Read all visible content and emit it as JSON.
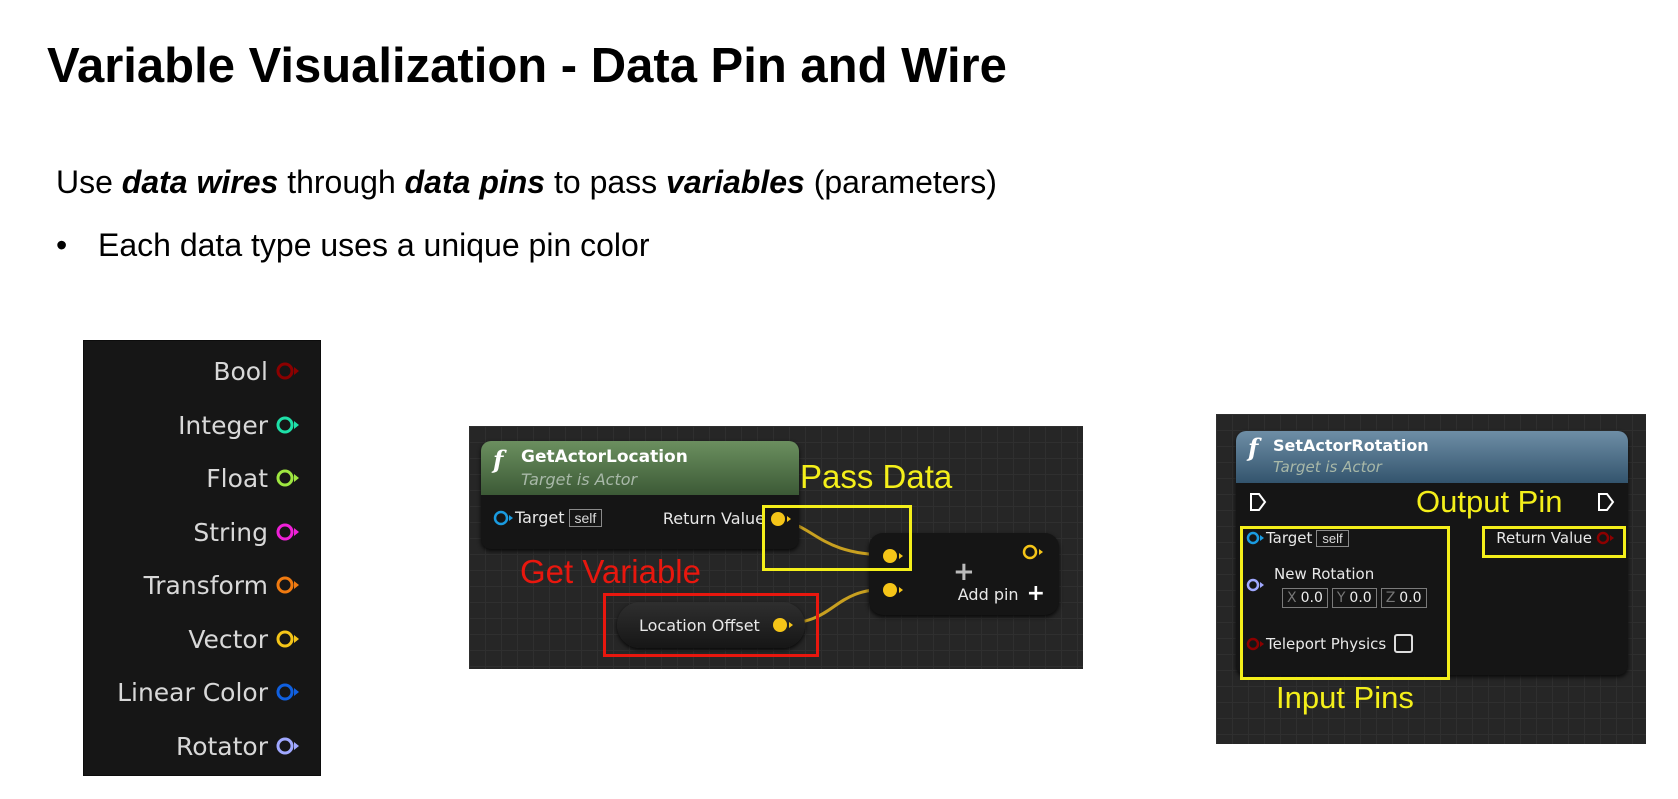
{
  "title": "Variable Visualization - Data Pin and Wire",
  "intro": {
    "t1": "Use ",
    "b1": "data wires",
    "t2": " through ",
    "b2": "data pins",
    "t3": " to pass ",
    "b3": "variables",
    "t4": " (parameters)"
  },
  "bullet": {
    "marker": "•",
    "text": "Each data type uses a unique pin color"
  },
  "pin_types": [
    {
      "label": "Bool",
      "color": "#8c0000"
    },
    {
      "label": "Integer",
      "color": "#1ee0a8"
    },
    {
      "label": "Float",
      "color": "#9ee640"
    },
    {
      "label": "String",
      "color": "#f020d8"
    },
    {
      "label": "Transform",
      "color": "#f07a10"
    },
    {
      "label": "Vector",
      "color": "#f5c518"
    },
    {
      "label": "Linear Color",
      "color": "#1060e0"
    },
    {
      "label": "Rotator",
      "color": "#a0a8ff"
    }
  ],
  "example1": {
    "node_title": "GetActorLocation",
    "node_subtitle": "Target is Actor",
    "target_label": "Target",
    "self_label": "self",
    "return_label": "Return Value",
    "variable_label": "Location Offset",
    "add_pin_label": "Add pin",
    "annotation_pass": "Pass Data",
    "annotation_get": "Get Variable",
    "function_glyph": "f",
    "plus_glyph": "+"
  },
  "example2": {
    "node_title": "SetActorRotation",
    "node_subtitle": "Target is Actor",
    "target_label": "Target",
    "self_label": "self",
    "rotation_label": "New Rotation",
    "x_label": "X",
    "x_value": "0.0",
    "y_label": "Y",
    "y_value": "0.0",
    "z_label": "Z",
    "z_value": "0.0",
    "teleport_label": "Teleport Physics",
    "return_label": "Return Value",
    "annotation_output": "Output Pin",
    "annotation_input": "Input Pins",
    "function_glyph": "f"
  },
  "colors": {
    "highlight_yellow": "#f4ef1a",
    "highlight_red": "#e8170e",
    "vector_pin": "#f5c518",
    "object_pin": "#1a9be0",
    "exec_pin": "#ffffff"
  }
}
